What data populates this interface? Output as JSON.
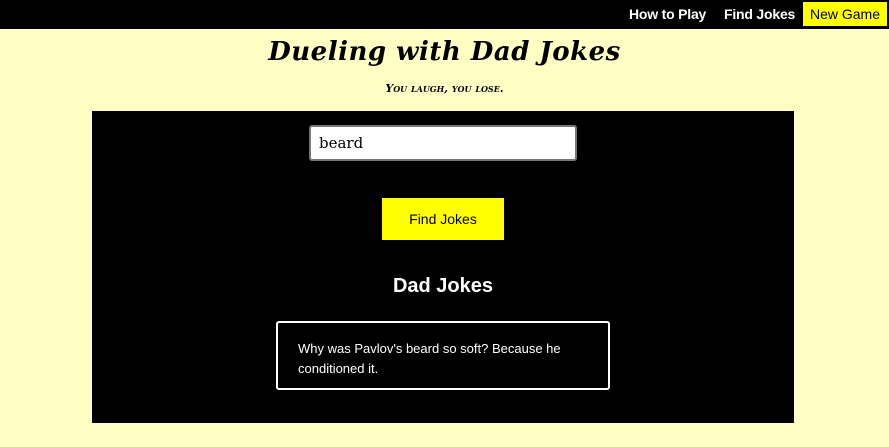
{
  "navbar": {
    "how_to_play": "How to Play",
    "find_jokes": "Find Jokes",
    "new_game": "New Game"
  },
  "header": {
    "title": "Dueling with Dad Jokes",
    "tagline": "You laugh, you lose."
  },
  "search": {
    "value": "beard",
    "button_label": "Find Jokes"
  },
  "results": {
    "heading": "Dad Jokes",
    "jokes": [
      "Why was Pavlov's beard so soft? Because he conditioned it."
    ]
  },
  "colors": {
    "background": "#ffffc4",
    "panel": "#000000",
    "accent": "#ffff00"
  }
}
